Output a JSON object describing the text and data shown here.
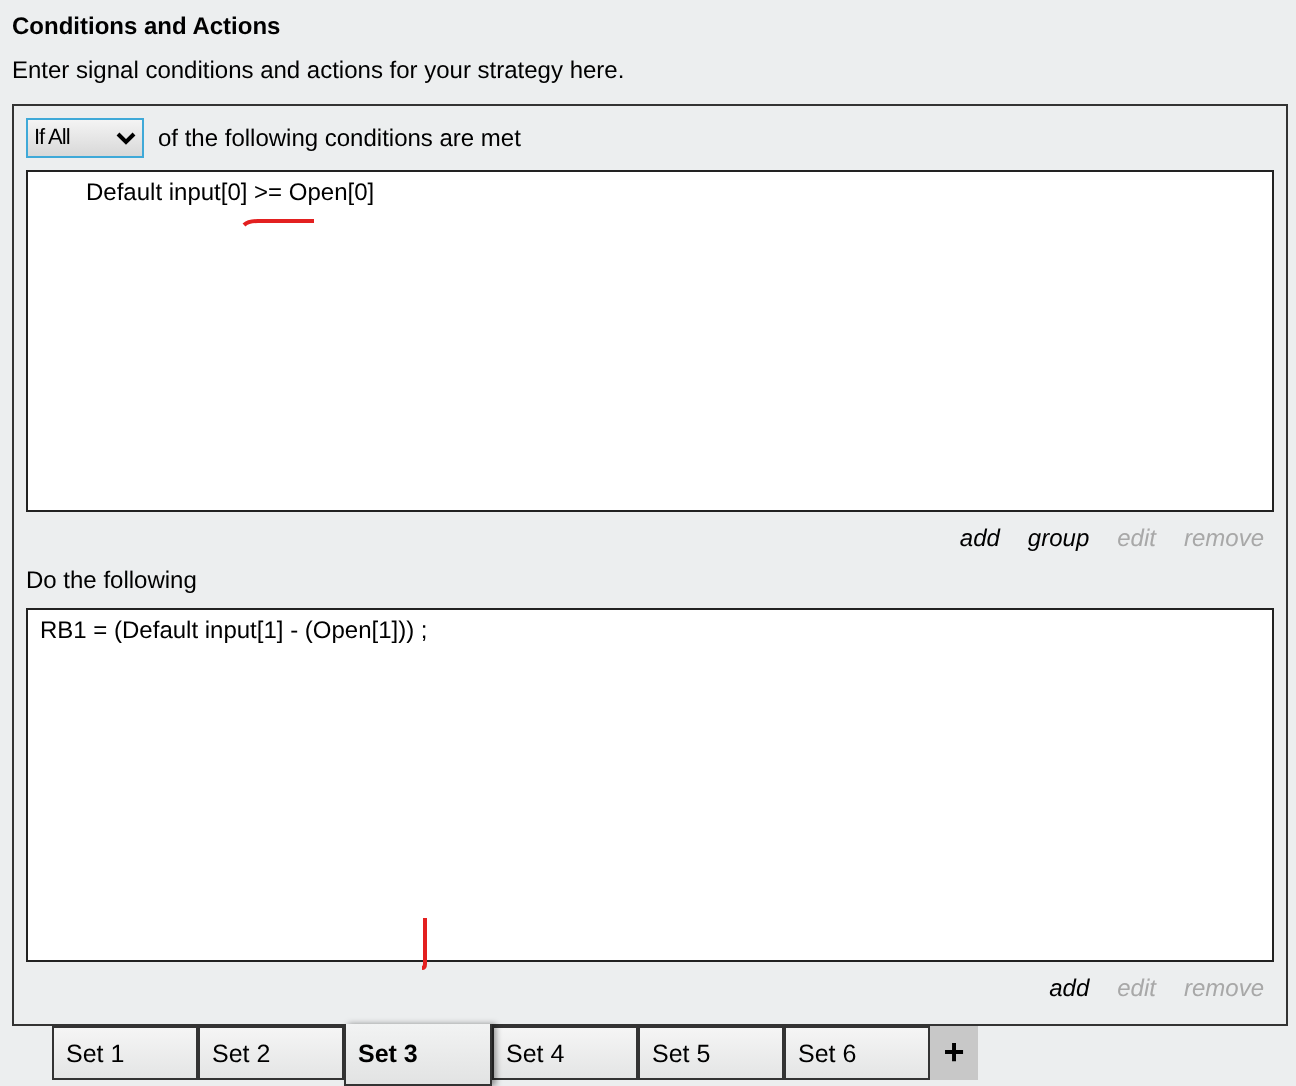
{
  "header": {
    "title": "Conditions and Actions",
    "subtitle": "Enter signal conditions and actions for your strategy here."
  },
  "conditions": {
    "mode": "If All",
    "mode_suffix": "of the following conditions are met",
    "items": [
      "Default input[0] >= Open[0]"
    ],
    "links": [
      {
        "label": "add",
        "disabled": false
      },
      {
        "label": "group",
        "disabled": false
      },
      {
        "label": "edit",
        "disabled": true
      },
      {
        "label": "remove",
        "disabled": true
      }
    ]
  },
  "actions": {
    "label": "Do the following",
    "items": [
      "RB1 = (Default input[1] - (Open[1])) ;"
    ],
    "links": [
      {
        "label": "add",
        "disabled": false
      },
      {
        "label": "edit",
        "disabled": true
      },
      {
        "label": "remove",
        "disabled": true
      }
    ]
  },
  "tabs": [
    {
      "label": "Set 1",
      "selected": false
    },
    {
      "label": "Set 2",
      "selected": false
    },
    {
      "label": "Set 3",
      "selected": true
    },
    {
      "label": "Set 4",
      "selected": false
    },
    {
      "label": "Set 5",
      "selected": false
    },
    {
      "label": "Set 6",
      "selected": false
    }
  ],
  "add_tab": "+"
}
